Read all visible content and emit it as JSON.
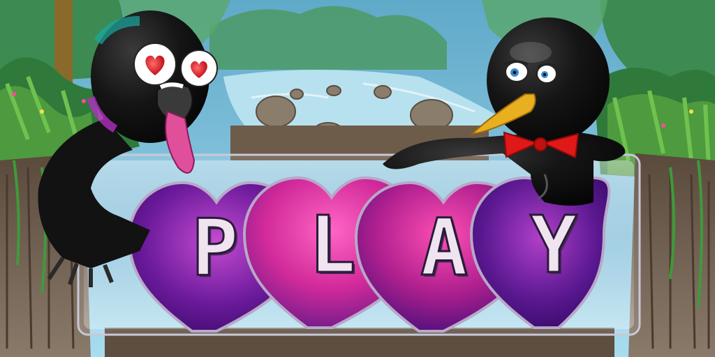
{
  "screen": "title-menu",
  "play_button": {
    "letters": [
      "P",
      "L",
      "A",
      "Y"
    ]
  },
  "characters": [
    {
      "name": "turkey-character",
      "eyes": "heart-eyes"
    },
    {
      "name": "penguin-character",
      "accessory": "red-bow-tie"
    }
  ],
  "colors": {
    "sky": "#7ec6de",
    "foliage_dark": "#2f7a3a",
    "foliage_light": "#5fae4a",
    "cliff": "#6b5a4a",
    "heart_purple": "#5a1a8a",
    "heart_pink": "#e23aa0",
    "bird_black": "#121212",
    "beak_yellow": "#e8b020",
    "bow_red": "#e01818",
    "heart_eye_red": "#e0202a"
  }
}
